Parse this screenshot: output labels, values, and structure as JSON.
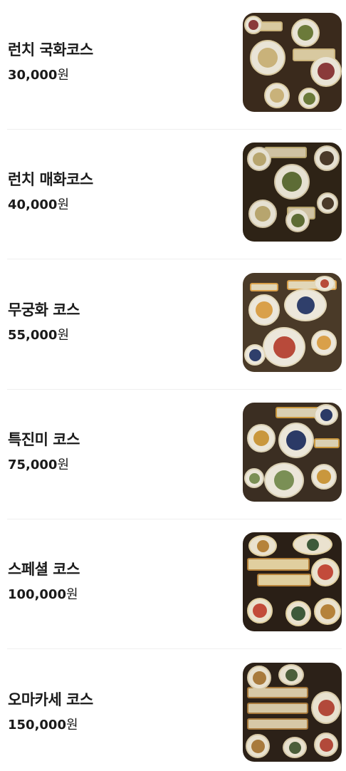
{
  "menu": {
    "currency_unit": "원",
    "items": [
      {
        "name": "런치 국화코스",
        "price": "30,000",
        "photo": "course-photo",
        "palette": [
          "#3a2a1c",
          "#e9e4d6",
          "#c9b27a",
          "#6b7a3a",
          "#8a3a3a",
          "#d8c9a0"
        ]
      },
      {
        "name": "런치 매화코스",
        "price": "40,000",
        "photo": "course-photo",
        "palette": [
          "#2e2316",
          "#e6e1d2",
          "#b7a56e",
          "#5d6c35",
          "#4a3a2a",
          "#cfc2a2"
        ]
      },
      {
        "name": "무궁화 코스",
        "price": "55,000",
        "photo": "course-photo",
        "palette": [
          "#4a3a28",
          "#ece7db",
          "#d9a04a",
          "#2f3f6b",
          "#b84a3a",
          "#e2d7b8"
        ]
      },
      {
        "name": "특진미 코스",
        "price": "75,000",
        "photo": "course-photo",
        "palette": [
          "#3b2e22",
          "#ebe6d9",
          "#c9973d",
          "#2b3a66",
          "#7a8f55",
          "#d9cfb2"
        ]
      },
      {
        "name": "스페셜 코스",
        "price": "100,000",
        "photo": "course-photo",
        "palette": [
          "#2a1f16",
          "#eae2cf",
          "#b5823a",
          "#3d5a3a",
          "#c24b3b",
          "#e0cf9f"
        ]
      },
      {
        "name": "오마카세 코스",
        "price": "150,000",
        "photo": "course-photo",
        "palette": [
          "#2c2118",
          "#e8e1cf",
          "#a87a3c",
          "#4b5e3a",
          "#b2493a",
          "#d6c8a6"
        ]
      }
    ]
  }
}
